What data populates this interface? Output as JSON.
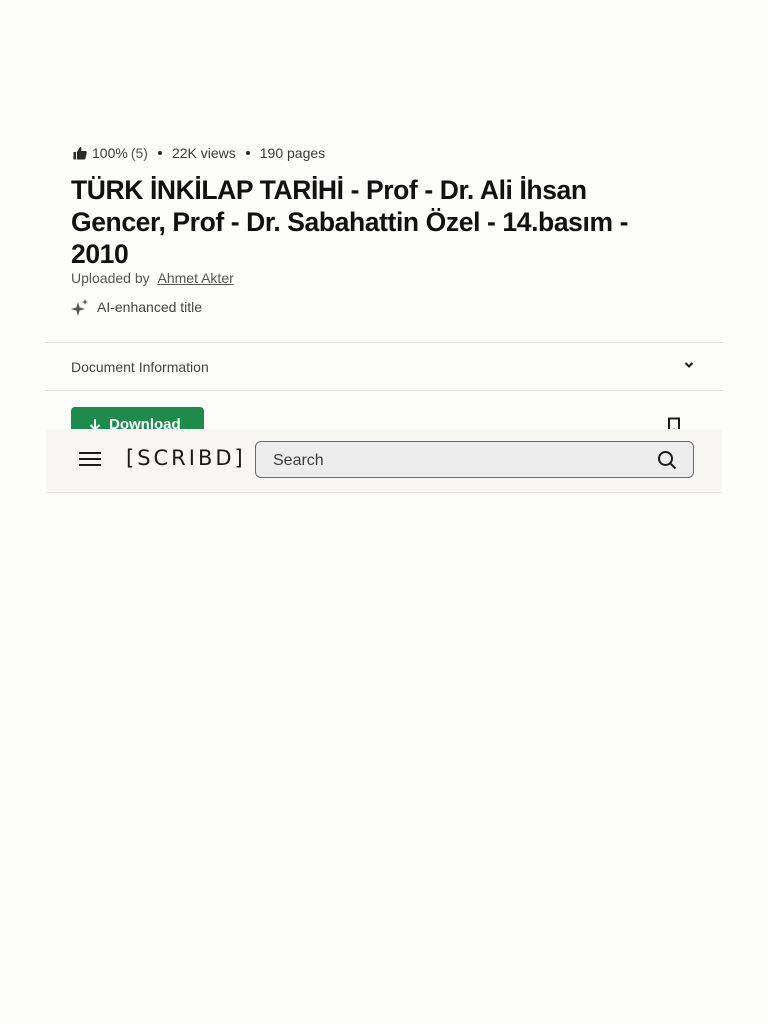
{
  "document": {
    "rating": "100%",
    "rating_count": "(5)",
    "views": "22K views",
    "pages": "190 pages",
    "title": "TÜRK İNKİLAP TARİHİ - Prof - Dr. Ali İhsan Gencer, Prof - Dr. Sabahattin Özel - 14.basım - 2010",
    "uploaded_by_label": "Uploaded by",
    "uploader": "Ahmet Akter",
    "ai_label": "AI-enhanced title"
  },
  "document_information": {
    "label": "Document Information"
  },
  "actions": {
    "download_label": "Download"
  },
  "header": {
    "logo": "[SCRIBD]",
    "search_placeholder": "Search"
  },
  "icons": {
    "rating": "thumbs-up-icon",
    "ai": "sparkle-icon",
    "chevron": "chevron-down-icon",
    "download": "download-arrow-icon",
    "bookmark": "bookmark-icon",
    "menu": "hamburger-menu-icon",
    "search": "search-icon"
  },
  "colors": {
    "download_button": "#1e8a4c",
    "header_background": "#f8f7f3",
    "search_background": "#ededed"
  }
}
